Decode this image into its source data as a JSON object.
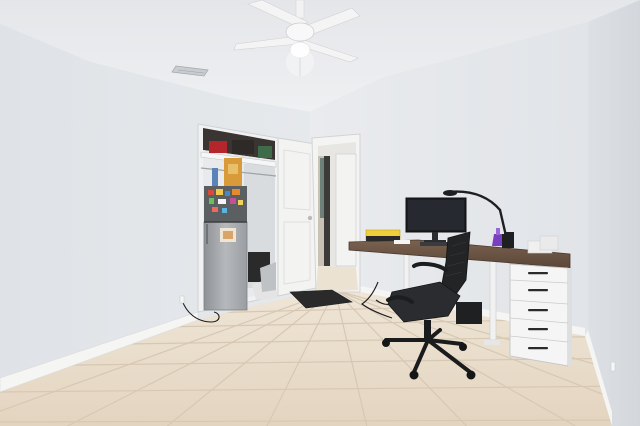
{
  "scene": {
    "type": "photograph",
    "setting": "home-office-bedroom",
    "colors": {
      "wall": "#e3e6e9",
      "ceiling": "#ebecee",
      "floor_tile": "#e8dccb",
      "grout": "#d2c4b0",
      "baseboard": "#f4f4f3",
      "door": "#f3f3f1",
      "desk_top": "#6b5544",
      "drawer_unit": "#f5f5f5",
      "chair": "#222426",
      "fridge_body": "#a9acaf",
      "fridge_top": "#5c5f62",
      "monitor": "#1c1d20",
      "lamp": "#1e1f22",
      "bottle_accent": "#7a3fc0",
      "doormat": "#2a2a2a",
      "closet_interior": "#3a3532"
    },
    "objects": [
      "ceiling-fan",
      "ceiling-vent",
      "closet-opening",
      "closet-shelf",
      "mini-fridge",
      "fridge-magnets",
      "open-door",
      "hallway-doorway",
      "doormat",
      "desk",
      "drawer-unit",
      "monitor",
      "desk-lamp",
      "office-chair",
      "floor-tiles",
      "baseboard",
      "power-outlet",
      "cables"
    ]
  }
}
